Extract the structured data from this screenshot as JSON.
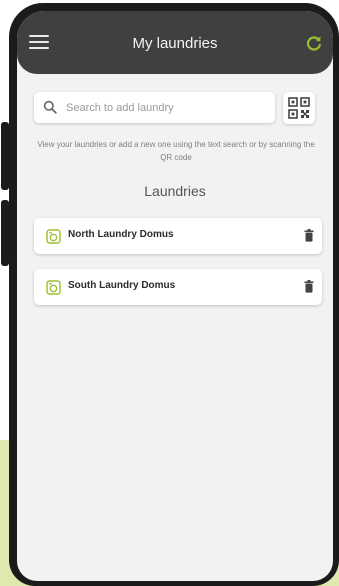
{
  "header": {
    "title": "My laundries",
    "menu_icon": "hamburger-menu-icon",
    "refresh_icon": "refresh-icon"
  },
  "search": {
    "placeholder": "Search to add laundry",
    "icon": "search-icon",
    "qr_icon": "qr-code-icon"
  },
  "hint": "View your laundries or add a new one using the text search or by scanning the QR code",
  "section_title": "Laundries",
  "laundries": [
    {
      "name": "North Laundry Domus",
      "icon": "washing-machine-icon",
      "action_icon": "trash-icon"
    },
    {
      "name": "South Laundry Domus",
      "icon": "washing-machine-icon",
      "action_icon": "trash-icon"
    }
  ],
  "colors": {
    "topbar": "#404040",
    "screen_bg": "#f2f2f2",
    "accent_green": "#9bbf2e",
    "background_green": "#dfe8ae"
  }
}
